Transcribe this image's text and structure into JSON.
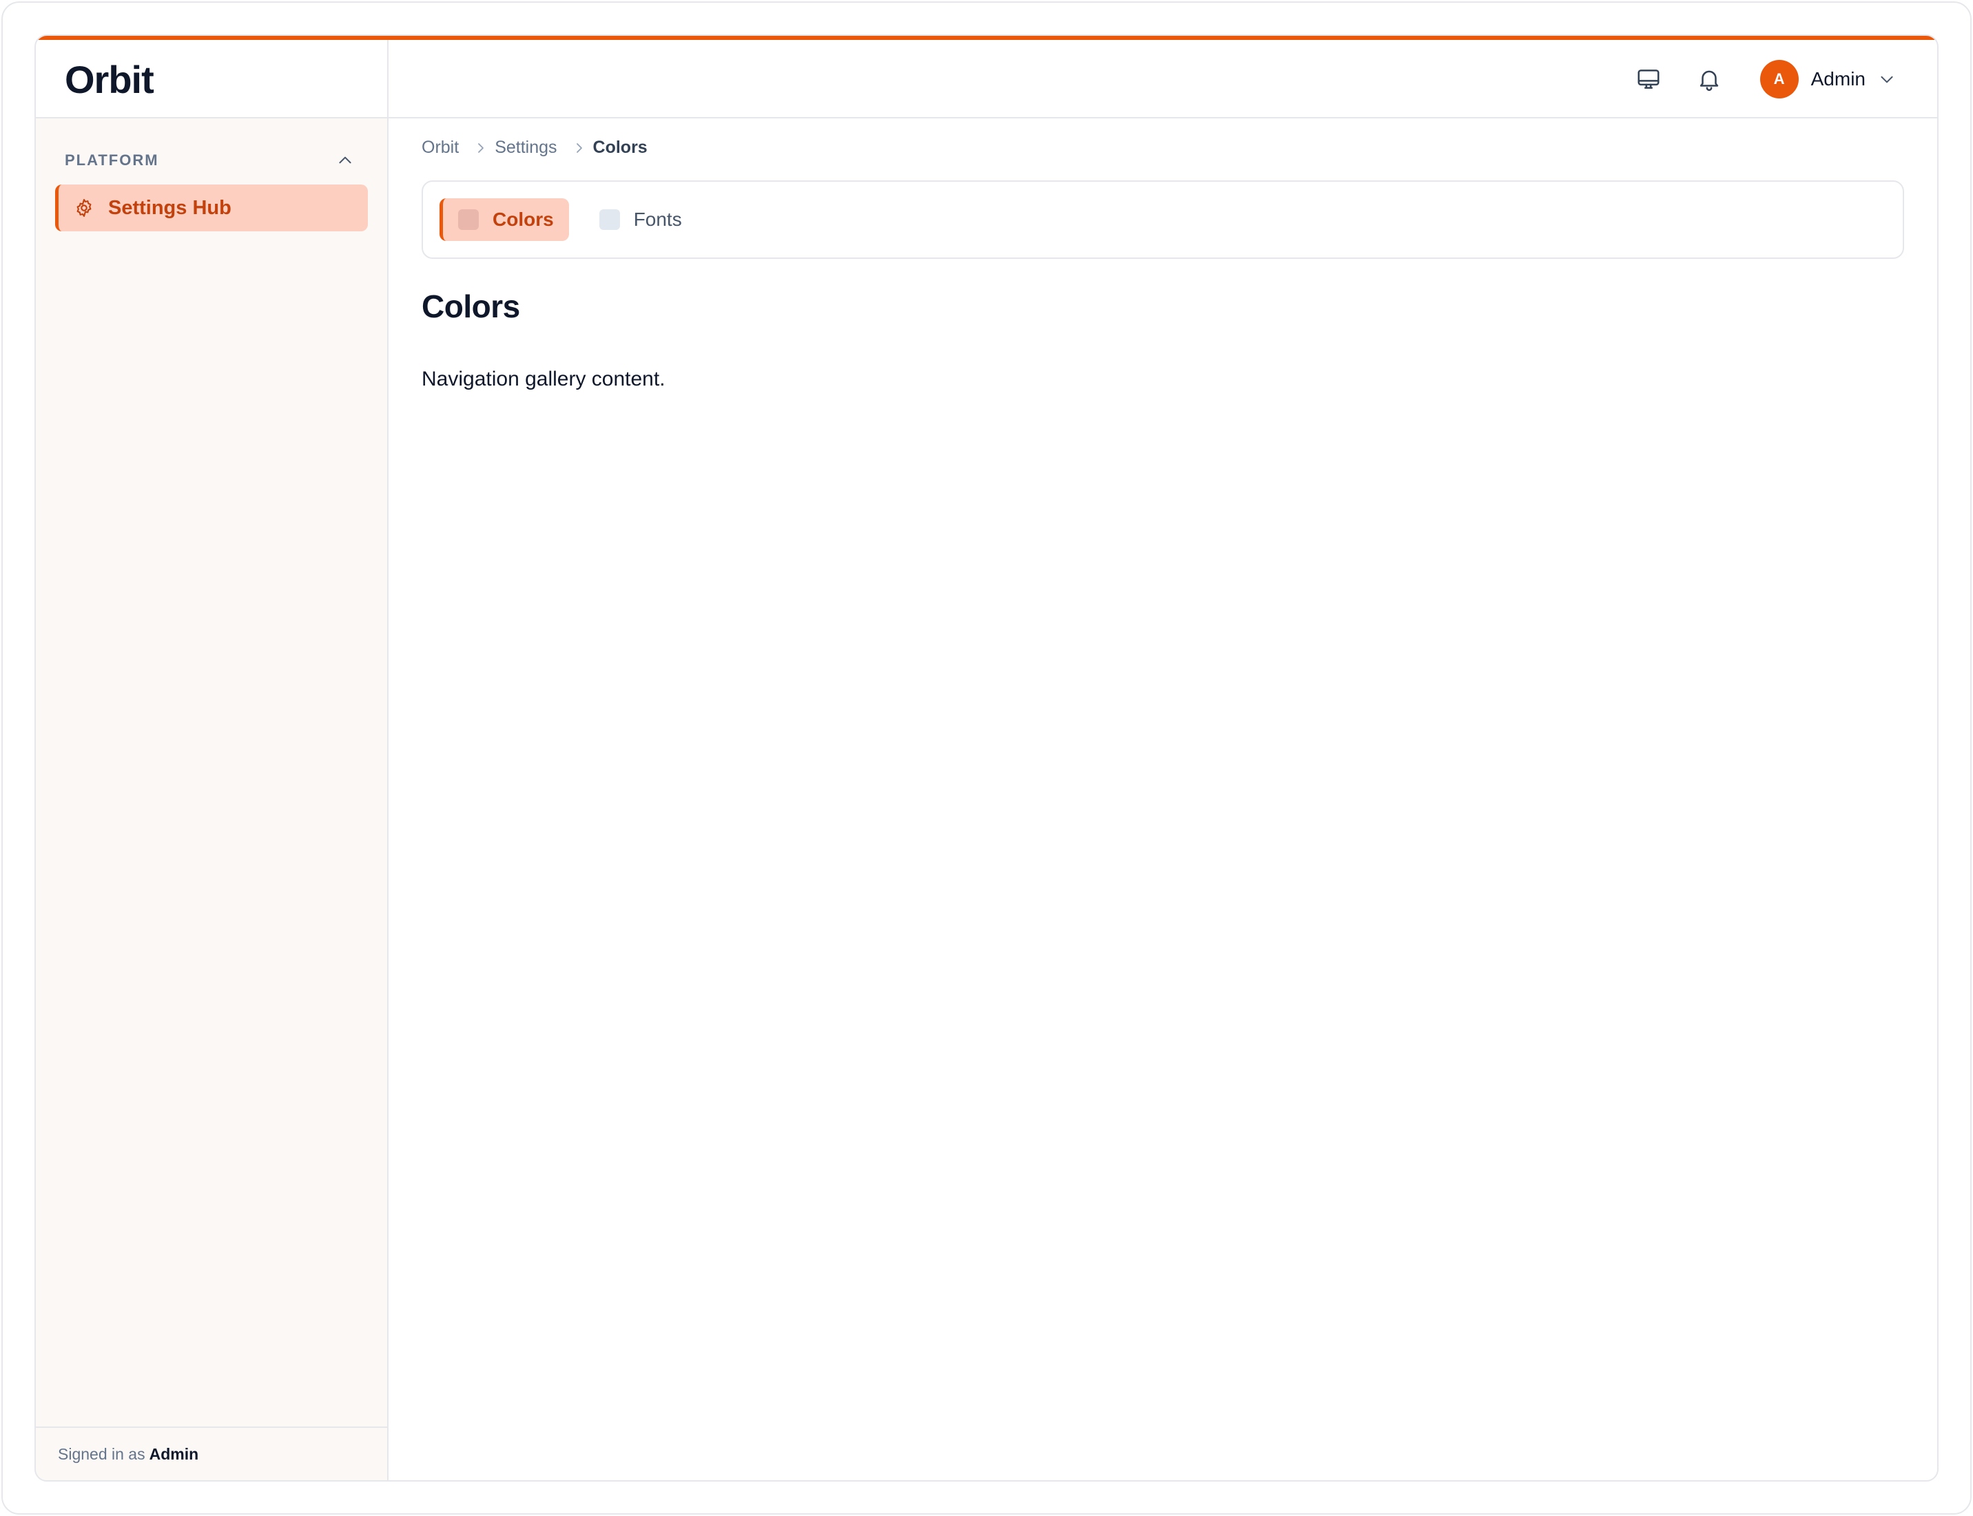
{
  "app": {
    "brand": "Orbit",
    "accent_color": "#ea580c"
  },
  "header": {
    "icons": [
      "monitor-icon",
      "bell-icon",
      "chevron-down-icon"
    ],
    "user": {
      "initial": "A",
      "name": "Admin"
    }
  },
  "sidebar": {
    "section_title": "PLATFORM",
    "items": [
      {
        "label": "Settings Hub",
        "icon": "gear-icon",
        "active": true
      }
    ],
    "footer": {
      "prefix": "Signed in as",
      "user": "Admin"
    }
  },
  "breadcrumb": {
    "items": [
      "Orbit",
      "Settings",
      "Colors"
    ]
  },
  "tabs": [
    {
      "label": "Colors",
      "active": true
    },
    {
      "label": "Fonts",
      "active": false
    }
  ],
  "main": {
    "title": "Colors",
    "body": "Navigation gallery content."
  }
}
